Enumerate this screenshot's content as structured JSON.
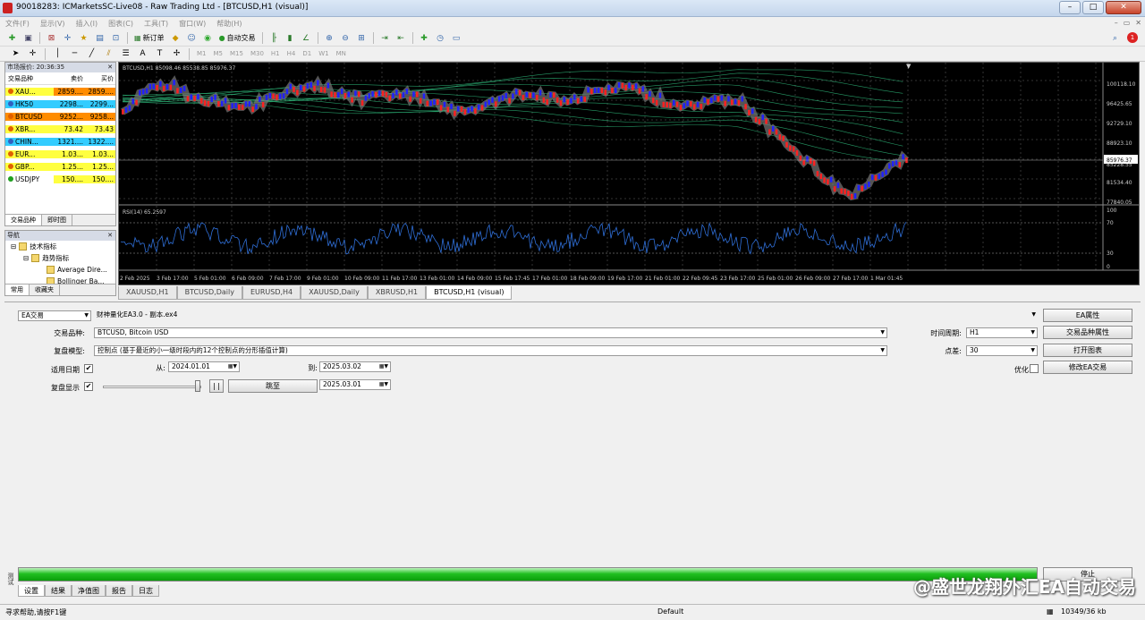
{
  "window": {
    "title": "90018283: ICMarketsSC-Live08 - Raw Trading Ltd - [BTCUSD,H1 (visual)]"
  },
  "menu": [
    "文件(F)",
    "显示(V)",
    "插入(I)",
    "图表(C)",
    "工具(T)",
    "窗口(W)",
    "帮助(H)"
  ],
  "toolbar": {
    "new_order": "新订单",
    "auto_trade": "自动交易"
  },
  "timeframes": [
    "M1",
    "M5",
    "M15",
    "M30",
    "H1",
    "H4",
    "D1",
    "W1",
    "MN"
  ],
  "watch": {
    "title": "市场报价: 20:36:35",
    "headers": [
      "交易品种",
      "卖价",
      "买价"
    ],
    "rows": [
      {
        "symbol": "XAU...",
        "bid": "2859....",
        "ask": "2859....",
        "bg": "#ffff40",
        "bidbg": "#ff8c00",
        "dot": "#e06000"
      },
      {
        "symbol": "HK50",
        "bid": "2298...",
        "ask": "2299...",
        "bg": "#33ccff",
        "bidbg": "#33ccff",
        "dot": "#3060c0"
      },
      {
        "symbol": "BTCUSD",
        "bid": "9252...",
        "ask": "9258...",
        "bg": "#ff8c00",
        "bidbg": "#ff8c00",
        "dot": "#e06000"
      },
      {
        "symbol": "XBR...",
        "bid": "73.42",
        "ask": "73.43",
        "bg": "#ffff40",
        "bidbg": "#ffff40",
        "dot": "#e06000"
      },
      {
        "symbol": "CHIN...",
        "bid": "1321....",
        "ask": "1322....",
        "bg": "#33ccff",
        "bidbg": "#33ccff",
        "dot": "#3060c0"
      },
      {
        "symbol": "EUR...",
        "bid": "1.03...",
        "ask": "1.03...",
        "bg": "#ffff40",
        "bidbg": "#ffff40",
        "dot": "#e06000"
      },
      {
        "symbol": "GBP...",
        "bid": "1.25...",
        "ask": "1.25...",
        "bg": "#ffff40",
        "bidbg": "#ffff40",
        "dot": "#e06000"
      },
      {
        "symbol": "USDJPY",
        "bid": "150....",
        "ask": "150....",
        "bg": "#ffffff",
        "bidbg": "#ffff40",
        "dot": "#20a020"
      }
    ],
    "tabs": [
      "交易品种",
      "即时图"
    ]
  },
  "navigator": {
    "title": "导航",
    "items": [
      "技术指标",
      "趋势指标",
      "Average Dire...",
      "Bollinger Ba..."
    ],
    "tabs": [
      "常用",
      "收藏夹"
    ]
  },
  "chart": {
    "header": "BTCUSD,H1 85098.46 85538.85 85976.37",
    "rsi_label": "RSI(14) 65.2597",
    "price_ticks": [
      "100118.10",
      "96425.65",
      "92729.10",
      "88923.10",
      "85976.37",
      "85228.55",
      "81534.40",
      "77840.05"
    ],
    "rsi_ticks": [
      "100",
      "70",
      "30",
      "0"
    ],
    "time_ticks": [
      "2 Feb 2025",
      "3 Feb 17:00",
      "5 Feb 01:00",
      "6 Feb 09:00",
      "7 Feb 17:00",
      "9 Feb 01:00",
      "10 Feb 09:00",
      "11 Feb 17:00",
      "13 Feb 01:00",
      "14 Feb 09:00",
      "15 Feb 17:45",
      "17 Feb 01:00",
      "18 Feb 09:00",
      "19 Feb 17:00",
      "21 Feb 01:00",
      "22 Feb 09:45",
      "23 Feb 17:00",
      "25 Feb 01:00",
      "26 Feb 09:00",
      "27 Feb 17:00",
      "1 Mar 01:45"
    ]
  },
  "chart_tabs": [
    "XAUUSD,H1",
    "BTCUSD,Daily",
    "EURUSD,H4",
    "XAUUSD,Daily",
    "XBRUSD,H1",
    "BTCUSD,H1 (visual)"
  ],
  "tester": {
    "mode": "EA交易",
    "ea_file": "财神量化EA3.0 - 副本.ex4",
    "symbol_label": "交易品种:",
    "symbol_value": "BTCUSD, Bitcoin USD",
    "model_label": "复盘模型:",
    "model_value": "控制点 (基于最近的小一级时段内的12个控制点的分形插值计算)",
    "date_label": "适用日期",
    "from_label": "从:",
    "from_value": "2024.01.01",
    "to_label": "到:",
    "to_value": "2025.03.02",
    "visual_label": "复盘显示",
    "pause_label": "| |",
    "jump_label": "跳至",
    "jump_date": "2025.03.01",
    "period_label": "时间周期:",
    "period_value": "H1",
    "spread_label": "点差:",
    "spread_value": "30",
    "optimize_label": "优化",
    "btn_ea_props": "EA属性",
    "btn_symbol_props": "交易品种属性",
    "btn_open_chart": "打开图表",
    "btn_modify_ea": "修改EA交易",
    "btn_stop": "停止",
    "progress": 1.0,
    "tabs": [
      "设置",
      "结果",
      "净值图",
      "报告",
      "日志"
    ],
    "side_label": "测试"
  },
  "status": {
    "help": "寻求帮助,请按F1键",
    "profile": "Default",
    "traffic": "10349/36 kb"
  },
  "watermark": "@盛世龙翔外汇EA自动交易",
  "colors": {
    "bull": "#2020ff",
    "bear": "#ff2020",
    "ma": "#30c080",
    "rsi": "#2f6fd8",
    "progress": "#22c022"
  }
}
